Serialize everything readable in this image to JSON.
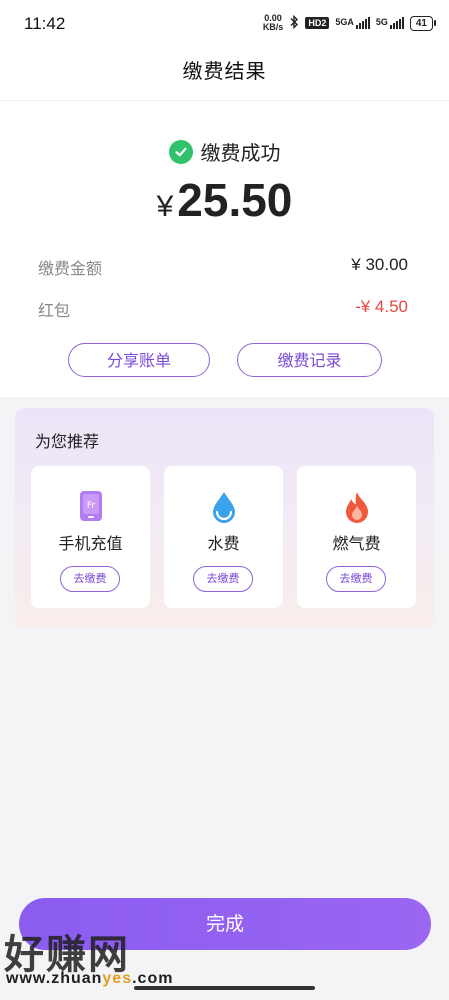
{
  "status_bar": {
    "time": "11:42",
    "net_speed_value": "0.00",
    "net_speed_unit": "KB/s",
    "hd_badge": "HD2",
    "signal1_label": "5GA",
    "signal2_label": "5G",
    "battery": "41"
  },
  "header": {
    "title": "缴费结果"
  },
  "result": {
    "status_text": "缴费成功",
    "currency_symbol": "¥",
    "amount": "25.50",
    "rows": [
      {
        "label": "缴费金额",
        "value": "¥ 30.00"
      },
      {
        "label": "红包",
        "value": "-¥ 4.50"
      }
    ],
    "share_label": "分享账单",
    "records_label": "缴费记录"
  },
  "recommend": {
    "title": "为您推荐",
    "cards": [
      {
        "name": "手机充值",
        "action": "去缴费",
        "icon": "phone-recharge-icon"
      },
      {
        "name": "水费",
        "action": "去缴费",
        "icon": "water-drop-icon"
      },
      {
        "name": "燃气费",
        "action": "去缴费",
        "icon": "flame-icon"
      }
    ]
  },
  "done_label": "完成",
  "watermark": {
    "cn": "好赚网",
    "url_prefix": "www.zhuan",
    "url_highlight": "yes",
    "url_suffix": ".com"
  },
  "colors": {
    "accent": "#8b5cf0",
    "success": "#2fc26a",
    "negative": "#e8473d"
  }
}
